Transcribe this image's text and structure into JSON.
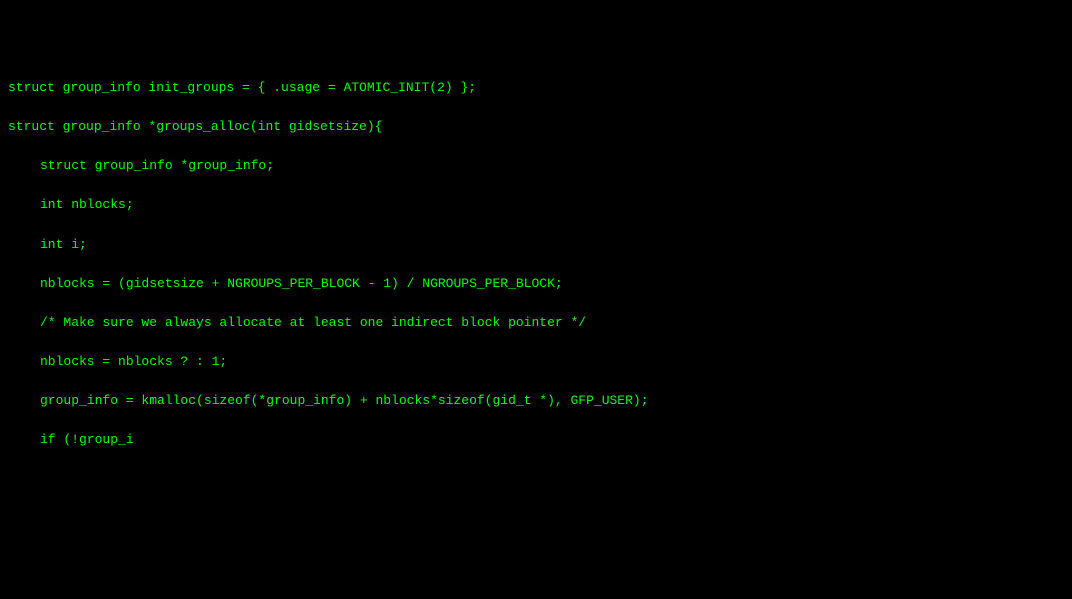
{
  "code": {
    "lines": [
      {
        "text": "struct group_info init_groups = { .usage = ATOMIC_INIT(2) };",
        "indented": false
      },
      {
        "text": "struct group_info *groups_alloc(int gidsetsize){",
        "indented": false
      },
      {
        "text": "struct group_info *group_info;",
        "indented": true
      },
      {
        "text": "int nblocks;",
        "indented": true
      },
      {
        "text": "int i;",
        "indented": true
      },
      {
        "text": "",
        "indented": true
      },
      {
        "text": "nblocks = (gidsetsize + NGROUPS_PER_BLOCK - 1) / NGROUPS_PER_BLOCK;",
        "indented": true
      },
      {
        "text": "/* Make sure we always allocate at least one indirect block pointer */",
        "indented": true
      },
      {
        "text": "nblocks = nblocks ? : 1;",
        "indented": true
      },
      {
        "text": "group_info = kmalloc(sizeof(*group_info) + nblocks*sizeof(gid_t *), GFP_USER);",
        "indented": true
      },
      {
        "text": "if (!group_i",
        "indented": true
      }
    ]
  },
  "colors": {
    "background": "#000000",
    "text": "#00ff00"
  }
}
